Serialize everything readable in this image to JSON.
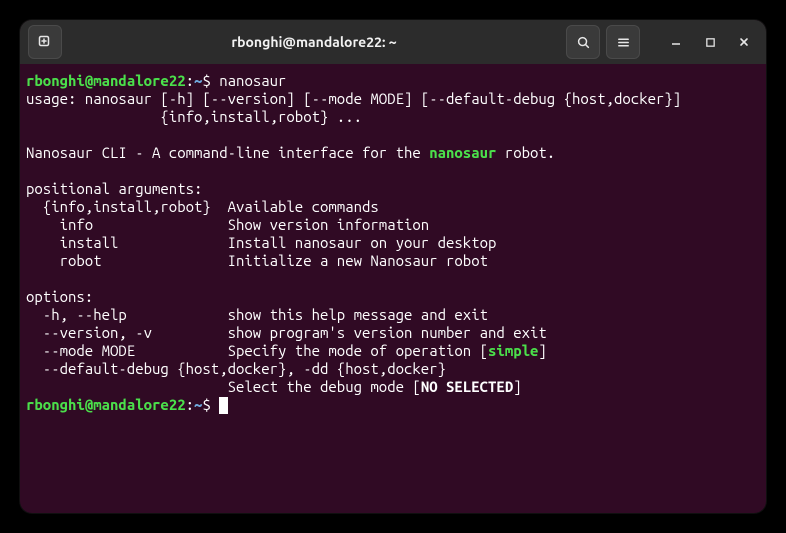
{
  "titlebar": {
    "title": "rbonghi@mandalore22: ~"
  },
  "prompt": {
    "user": "rbonghi",
    "host": "mandalore22",
    "path": "~",
    "dollar": "$"
  },
  "lines": {
    "cmd1": "nanosaur",
    "usage1": "usage: nanosaur [-h] [--version] [--mode MODE] [--default-debug {host,docker}]",
    "usage2": "                {info,install,robot} ...",
    "blank": "",
    "desc_pre": "Nanosaur CLI - A command-line interface for the ",
    "desc_link": "nanosaur",
    "desc_post": " robot.",
    "posargs_hdr": "positional arguments:",
    "posargs1": "  {info,install,robot}  Available commands",
    "posargs2": "    info                Show version information",
    "posargs3": "    install             Install nanosaur on your desktop",
    "posargs4": "    robot               Initialize a new Nanosaur robot",
    "opts_hdr": "options:",
    "opts1": "  -h, --help            show this help message and exit",
    "opts2": "  --version, -v         show program's version number and exit",
    "opts3_pre": "  --mode MODE           Specify the mode of operation [",
    "opts3_mode": "simple",
    "opts3_post": "]",
    "opts4": "  --default-debug {host,docker}, -dd {host,docker}",
    "opts5_pre": "                        Select the debug mode [",
    "opts5_bold": "NO SELECTED",
    "opts5_post": "]"
  }
}
